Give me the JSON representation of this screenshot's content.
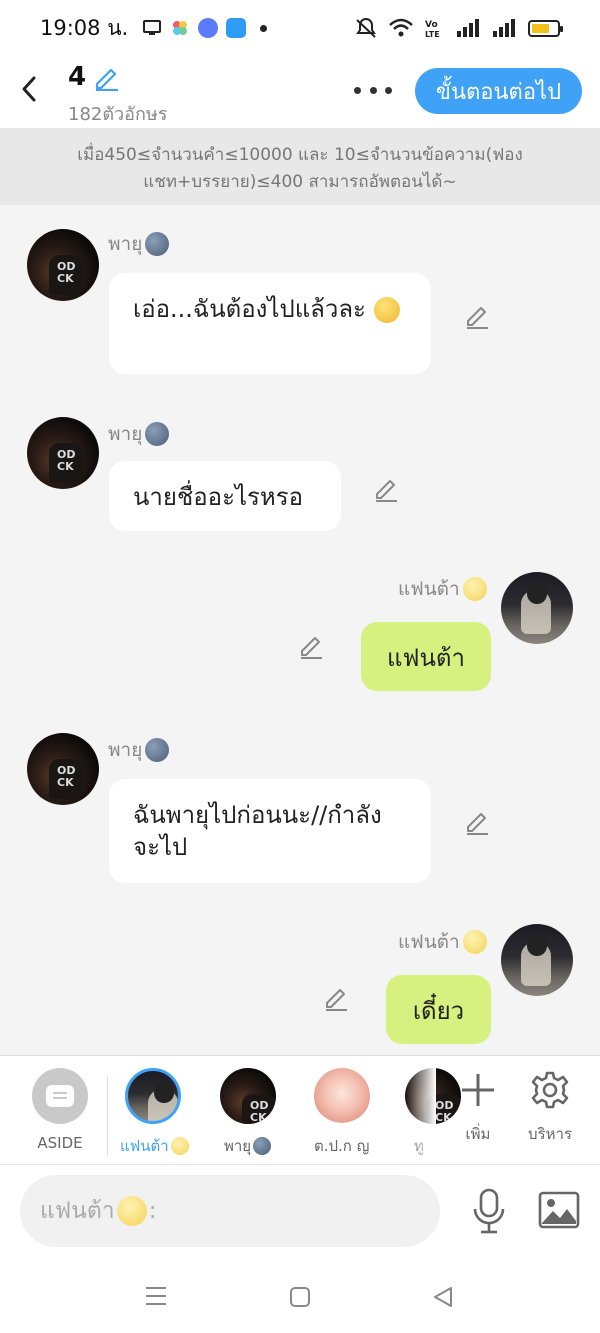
{
  "status_bar": {
    "time": "19:08 น."
  },
  "header": {
    "title": "4",
    "subtitle": "182ตัวอักษร",
    "next_label": "ขั้นตอนต่อไป"
  },
  "notice": "เมื่อ450≤จำนวนคำ≤10000 และ 10≤จำนวนข้อความ(ฟองแชท+บรรยาย)≤400 สามารถอัพตอนได้~",
  "messages": [
    {
      "sender": "พายุ",
      "side": "left",
      "text": "เอ่อ...ฉันต้องไปแล้วละ"
    },
    {
      "sender": "พายุ",
      "side": "left",
      "text": "นายชื่ออะไรหรอ"
    },
    {
      "sender": "แฟนต้า",
      "side": "right",
      "text": "แฟนต้า"
    },
    {
      "sender": "พายุ",
      "side": "left",
      "text": "ฉันพายุไปก่อนนะ//กำลังจะไป"
    },
    {
      "sender": "แฟนต้า",
      "side": "right",
      "text": "เดี๋ยว"
    }
  ],
  "character_bar": {
    "aside_label": "ASIDE",
    "characters": [
      {
        "name": "แฟนต้า",
        "selected": true
      },
      {
        "name": "พายุ",
        "selected": false
      },
      {
        "name": "ต.ป.ก ญ",
        "selected": false
      },
      {
        "name": "ทู",
        "selected": false
      }
    ],
    "add_label": "เพิ่ม",
    "manage_label": "บริหาร"
  },
  "input": {
    "placeholder_name": "แฟนต้า",
    "placeholder_suffix": ":"
  },
  "colors": {
    "accent": "#3fa2f6",
    "my_bubble": "#d6f17f",
    "other_bubble": "#ffffff",
    "background": "#f4f4f4"
  }
}
